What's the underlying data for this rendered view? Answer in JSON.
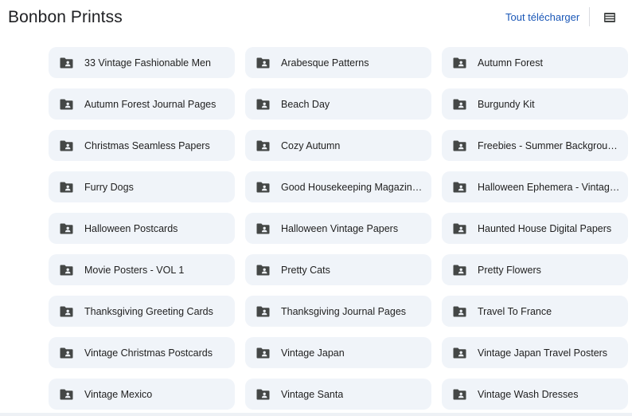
{
  "header": {
    "title": "Bonbon Printss",
    "download_label": "Tout télécharger",
    "view_icon": "list-view-icon"
  },
  "folder_icon": "shared-folder-icon",
  "colors": {
    "tile_bg": "#f0f4f9",
    "link": "#1a57b7",
    "icon": "#444746"
  },
  "folders": [
    "33 Vintage Fashionable Men",
    "Arabesque Patterns",
    "Autumn Forest",
    "Autumn Forest Journal Pages",
    "Beach Day",
    "Burgundy Kit",
    "Christmas Seamless Papers",
    "Cozy Autumn",
    "Freebies - Summer Backgrounds",
    "Furry Dogs",
    "Good Housekeeping Magazine C...",
    "Halloween Ephemera - Vintage ...",
    "Halloween Postcards",
    "Halloween Vintage Papers",
    "Haunted House Digital Papers",
    "Movie Posters - VOL 1",
    "Pretty Cats",
    "Pretty Flowers",
    "Thanksgiving Greeting Cards",
    "Thanksgiving Journal Pages",
    "Travel To France",
    "Vintage Christmas Postcards",
    "Vintage Japan",
    "Vintage Japan Travel Posters",
    "Vintage Mexico",
    "Vintage Santa",
    "Vintage Wash Dresses"
  ]
}
